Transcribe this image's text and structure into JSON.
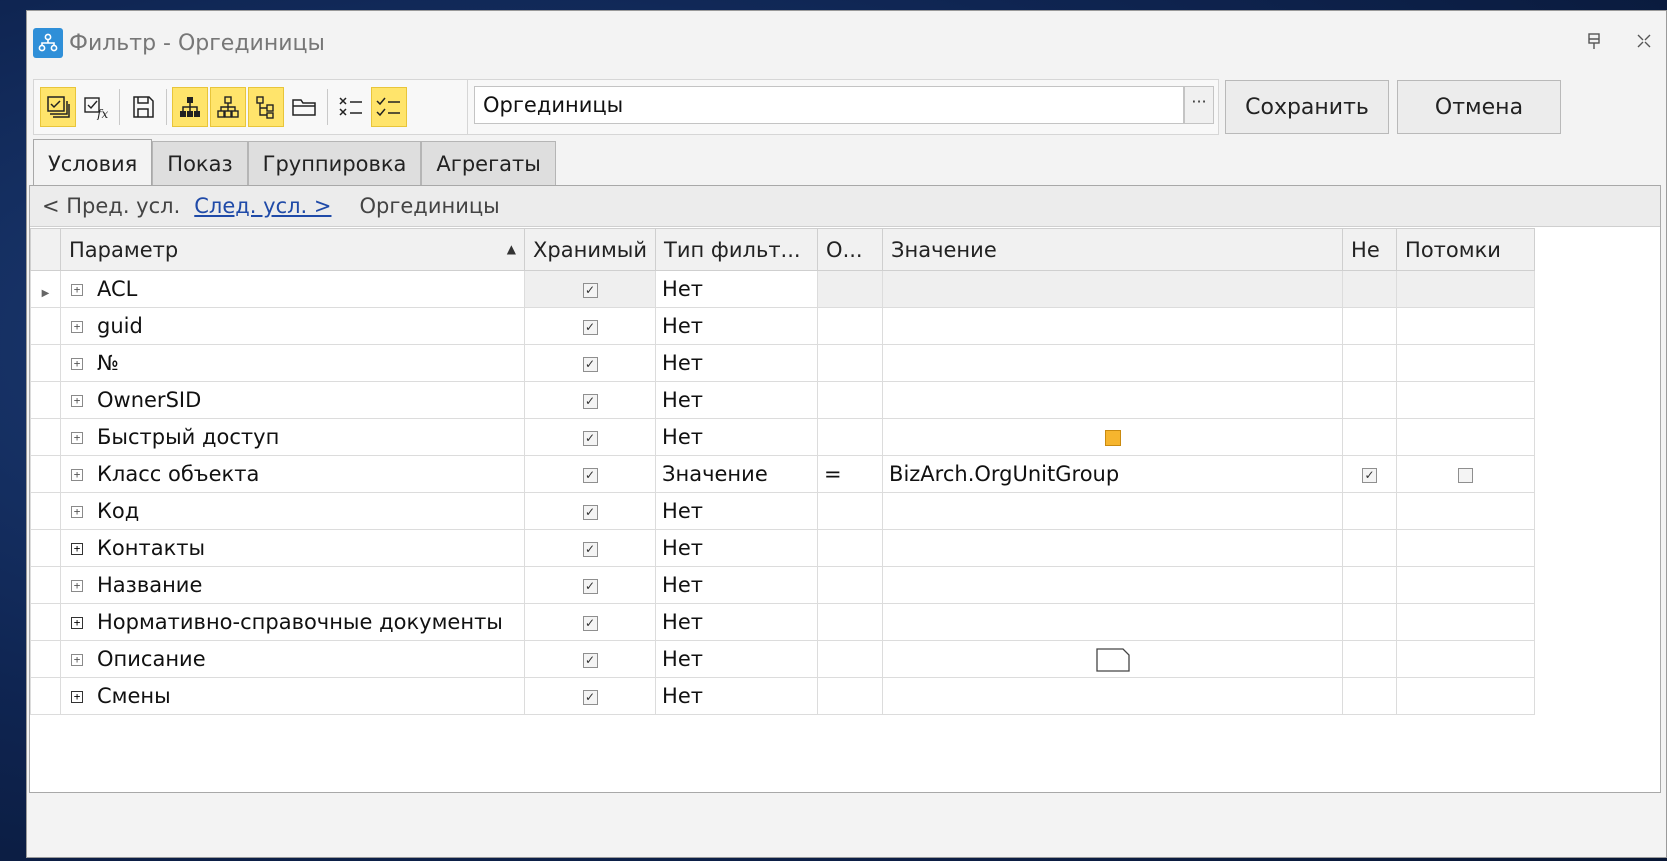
{
  "window": {
    "title": "Фильтр - Оргединицы"
  },
  "toolbar": {
    "icons": [
      "layers-icon",
      "formula-check-icon",
      "save-icon",
      "hierarchy-icon",
      "hierarchy-outline-icon",
      "tree-icon",
      "folder-icon",
      "uncheck-list-icon",
      "check-list-icon"
    ]
  },
  "filter": {
    "name": "Оргединицы",
    "ellipsis": "···"
  },
  "buttons": {
    "save": "Сохранить",
    "cancel": "Отмена"
  },
  "tabs": [
    "Условия",
    "Показ",
    "Группировка",
    "Агрегаты"
  ],
  "nav": {
    "prev": "< Пред. усл.",
    "next": "След. усл. >",
    "current": "Оргединицы"
  },
  "columns": {
    "param": "Параметр",
    "stored": "Хранимый",
    "type": "Тип фильт...",
    "op": "О...",
    "value": "Значение",
    "not": "Не",
    "desc": "Потомки"
  },
  "rows": [
    {
      "param": "ACL",
      "type": "Нет",
      "op": "",
      "value": "",
      "expander": "light"
    },
    {
      "param": "guid",
      "type": "Нет",
      "op": "",
      "value": "",
      "expander": "light"
    },
    {
      "param": "№",
      "type": "Нет",
      "op": "",
      "value": "",
      "expander": "light"
    },
    {
      "param": "OwnerSID",
      "type": "Нет",
      "op": "",
      "value": "",
      "expander": "light"
    },
    {
      "param": "Быстрый доступ",
      "type": "Нет",
      "op": "",
      "value": "",
      "expander": "light"
    },
    {
      "param": "Класс объекта",
      "type": "Значение",
      "op": "=",
      "value": "BizArch.OrgUnitGroup",
      "expander": "light"
    },
    {
      "param": "Код",
      "type": "Нет",
      "op": "",
      "value": "",
      "expander": "light"
    },
    {
      "param": "Контакты",
      "type": "Нет",
      "op": "",
      "value": "",
      "expander": "bold"
    },
    {
      "param": "Название",
      "type": "Нет",
      "op": "",
      "value": "",
      "expander": "light"
    },
    {
      "param": "Нормативно-справочные документы",
      "type": "Нет",
      "op": "",
      "value": "",
      "expander": "bold"
    },
    {
      "param": "Описание",
      "type": "Нет",
      "op": "",
      "value": "",
      "expander": "light"
    },
    {
      "param": "Смены",
      "type": "Нет",
      "op": "",
      "value": "",
      "expander": "bold"
    }
  ]
}
